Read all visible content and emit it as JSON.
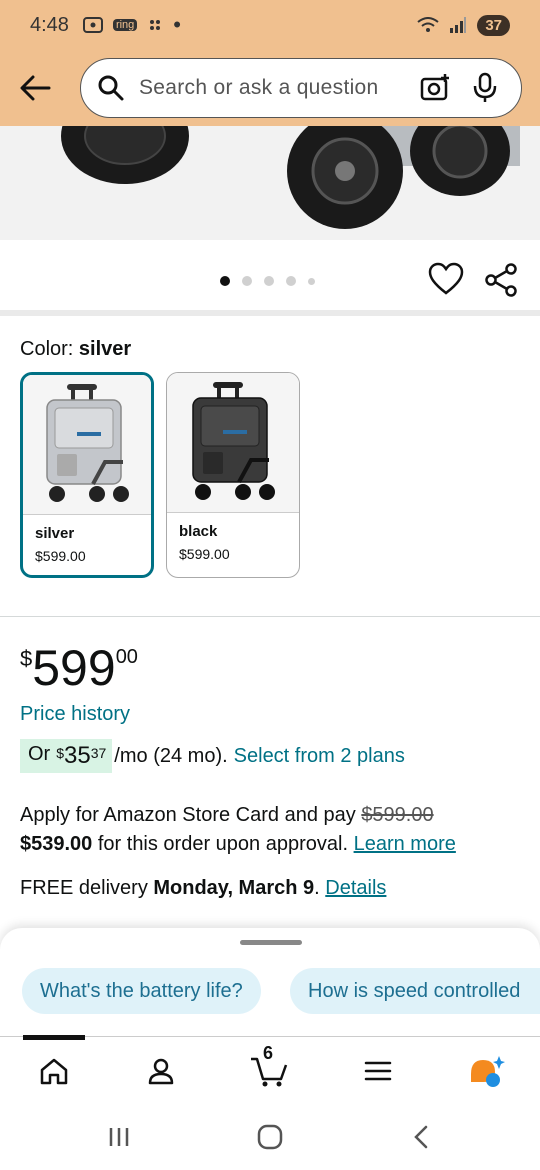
{
  "status": {
    "time": "4:48",
    "battery": "37",
    "notif_label": "ring"
  },
  "search": {
    "placeholder": "Search or ask a question"
  },
  "gallery": {
    "dot_count": 5,
    "active_index": 0
  },
  "color": {
    "label": "Color:",
    "selected": "silver",
    "options": [
      {
        "name": "silver",
        "price": "$599.00",
        "color": "#b9bcc1"
      },
      {
        "name": "black",
        "price": "$599.00",
        "color": "#3a3a3a"
      }
    ]
  },
  "price": {
    "symbol": "$",
    "whole": "599",
    "fraction": "00"
  },
  "price_history": "Price history",
  "monthly": {
    "or": "Or",
    "symbol": "$",
    "whole": "35",
    "fraction": "37",
    "suffix": "/mo (24 mo).",
    "link": "Select from 2 plans"
  },
  "store_card": {
    "text1": "Apply for Amazon Store Card and pay",
    "old_price": "$599.00",
    "new_price": "$539.00",
    "text2": "for this order upon approval.",
    "link": "Learn more"
  },
  "delivery": {
    "prefix": "FREE delivery",
    "date": "Monday, March 9",
    "period": ".",
    "link": "Details"
  },
  "chips": [
    "What's the battery life?",
    "How is speed controlled"
  ],
  "nav": {
    "cart_count": "6"
  },
  "colors": {
    "accent_teal": "#007185",
    "header_bg": "#f0c08f",
    "chip_bg": "#dff2f9",
    "deal_bg": "#d8f3e4"
  }
}
